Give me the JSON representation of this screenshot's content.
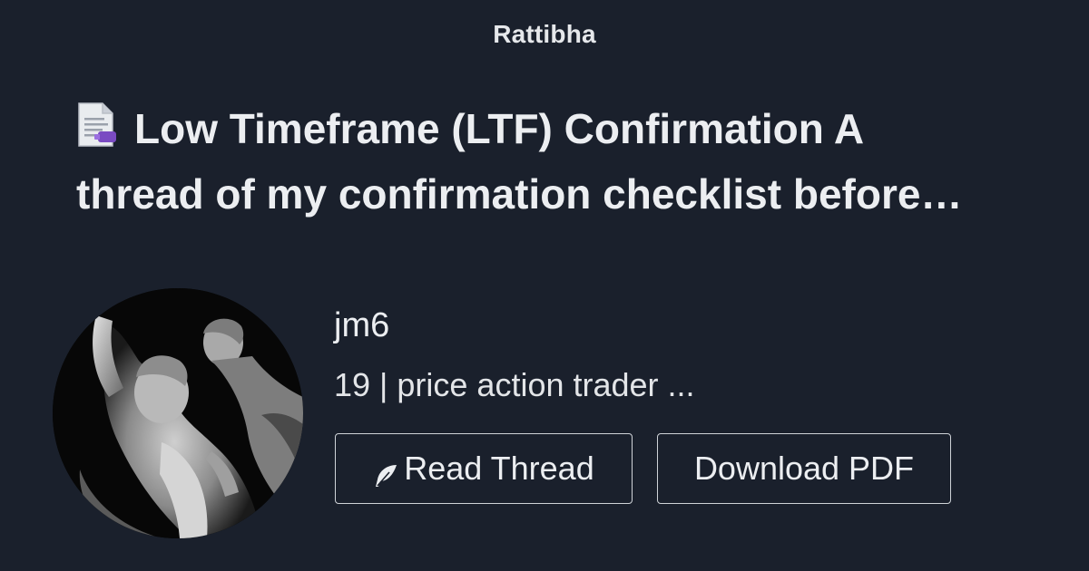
{
  "brand": {
    "name": "Rattibha"
  },
  "thread": {
    "icon": "document-icon",
    "title_line1": "Low Timeframe (LTF) Confirmation A",
    "title_line2": "thread of my confirmation checklist before…"
  },
  "author": {
    "avatar": "avatar-statue-image",
    "name": "jm6",
    "bio": "19 | price action trader ..."
  },
  "actions": {
    "read_icon": "feather-icon",
    "read_label": "Read Thread",
    "pdf_label": "Download PDF"
  },
  "colors": {
    "background": "#1a202c",
    "text": "#eceef1",
    "button_border": "#cfd3d8",
    "icon_accent": "#7a4bc2"
  }
}
